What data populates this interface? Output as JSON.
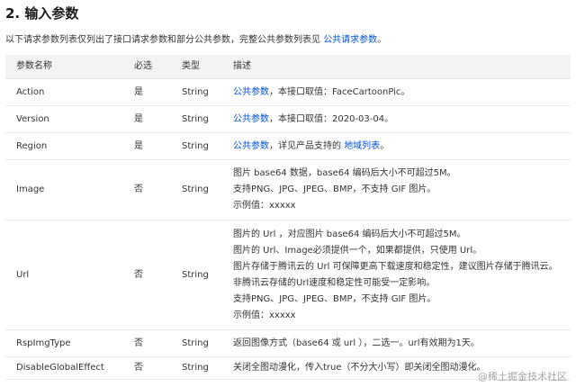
{
  "heading": "2. 输入参数",
  "intro": {
    "text": "以下请求参数列表仅列出了接口请求参数和部分公共参数，完整公共参数列表见",
    "link": "公共请求参数",
    "suffix": "。"
  },
  "table": {
    "headers": [
      "参数名称",
      "必选",
      "类型",
      "描述"
    ],
    "rows": [
      {
        "name": "Action",
        "required": "是",
        "type": "String",
        "desc_link": "公共参数",
        "desc_text": "，本接口取值：FaceCartoonPic。"
      },
      {
        "name": "Version",
        "required": "是",
        "type": "String",
        "desc_link": "公共参数",
        "desc_text": "，本接口取值：2020-03-04。"
      },
      {
        "name": "Region",
        "required": "是",
        "type": "String",
        "desc_link": "公共参数",
        "desc_text": "，详见产品支持的",
        "desc_link2": "地域列表",
        "desc_tail": "。"
      },
      {
        "name": "Image",
        "required": "否",
        "type": "String",
        "lines": [
          "图片 base64 数据，base64 编码后大小不可超过5M。",
          "支持PNG、JPG、JPEG、BMP，不支持 GIF 图片。",
          "示例值：xxxxx"
        ]
      },
      {
        "name": "Url",
        "required": "否",
        "type": "String",
        "lines": [
          "图片的 Url ，对应图片 base64 编码后大小不可超过5M。",
          "图片的 Url、Image必须提供一个，如果都提供，只使用 Url。",
          "图片存储于腾讯云的 Url 可保障更高下载速度和稳定性，建议图片存储于腾讯云。",
          "非腾讯云存储的Url速度和稳定性可能受一定影响。",
          "支持PNG、JPG、JPEG、BMP，不支持 GIF 图片。",
          "示例值：xxxxx"
        ]
      },
      {
        "name": "RspImgType",
        "required": "否",
        "type": "String",
        "lines": [
          "返回图像方式（base64 或 url ），二选一。url有效期为1天。"
        ]
      },
      {
        "name": "DisableGlobalEffect",
        "required": "否",
        "type": "String",
        "lines": [
          "关闭全图动漫化，传入true（不分大小写）即关闭全图动漫化。"
        ]
      }
    ]
  },
  "watermark": "@稀土掘金技术社区"
}
